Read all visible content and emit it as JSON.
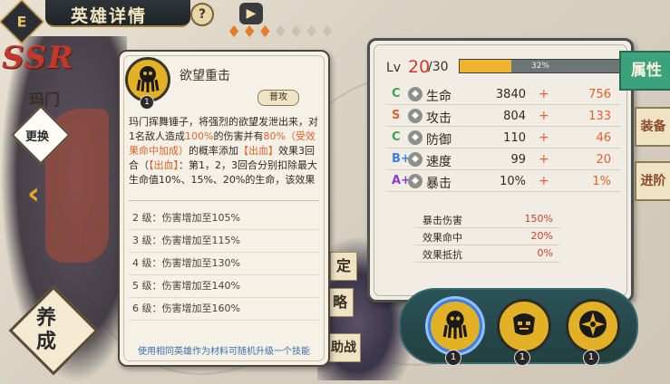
{
  "header": {
    "back_icon": "back-icon",
    "back_glyph": "E",
    "title": "英雄详情",
    "help_label": "?",
    "play_label": "▶",
    "stars_lit": 3,
    "stars_total": 7
  },
  "hero": {
    "rarity": "SSR",
    "name": "玛门",
    "change_label": "更换",
    "train_label": "养成"
  },
  "side_tabs": [
    "定",
    "略",
    "助战"
  ],
  "skill_card": {
    "icon": "octopus-skill-icon",
    "level": "1",
    "name": "欲望重击",
    "tag": "普攻",
    "desc_parts": [
      {
        "text": "玛门挥舞锤子，将强烈的欲望发泄出来，对1名敌人造成",
        "style": "plain"
      },
      {
        "text": "100%",
        "style": "orange"
      },
      {
        "text": "的伤害并有",
        "style": "plain"
      },
      {
        "text": "80%（受效果命中加成）",
        "style": "orange"
      },
      {
        "text": "的概率添加",
        "style": "plain"
      },
      {
        "text": "【出血】",
        "style": "orange"
      },
      {
        "text": "效果3回合（",
        "style": "plain"
      },
      {
        "text": "【出血】",
        "style": "orange"
      },
      {
        "text": "：第1，2，3回合分别扣除最大生命值10%、15%、20%的生命，该效果",
        "style": "plain"
      }
    ],
    "upgrades": [
      "2 级：伤害增加至105%",
      "3 级：伤害增加至115%",
      "4 级：伤害增加至130%",
      "5 级：伤害增加至140%",
      "6 级：伤害增加至160%"
    ],
    "footer": "使用相同英雄作为材料可随机升级一个技能"
  },
  "stats": {
    "lv_label": "Lv",
    "lv_current": "20",
    "lv_max": "/30",
    "xp_percent_text": "32%",
    "xp_fraction": 0.32,
    "rows": [
      {
        "grade": "C",
        "grade_color": "#3aa24a",
        "icon": "heart-icon",
        "name": "生命",
        "value": "3840",
        "plus": "+",
        "bonus": "756"
      },
      {
        "grade": "S",
        "grade_color": "#e0622a",
        "icon": "sword-icon",
        "name": "攻击",
        "value": "804",
        "plus": "+",
        "bonus": "133"
      },
      {
        "grade": "C",
        "grade_color": "#3aa24a",
        "icon": "shield-icon",
        "name": "防御",
        "value": "110",
        "plus": "+",
        "bonus": "46"
      },
      {
        "grade": "B+",
        "grade_color": "#3a7ee6",
        "icon": "speed-icon",
        "name": "速度",
        "value": "99",
        "plus": "+",
        "bonus": "20"
      },
      {
        "grade": "A+",
        "grade_color": "#8a3ad1",
        "icon": "crit-icon",
        "name": "暴击",
        "value": "10%",
        "plus": "+",
        "bonus": "1%"
      }
    ],
    "sub_rows": [
      {
        "name": "暴击伤害",
        "value": "150%"
      },
      {
        "name": "效果命中",
        "value": "20%"
      },
      {
        "name": "效果抵抗",
        "value": "0%"
      }
    ]
  },
  "right_tabs": [
    "属性",
    "装备",
    "进阶"
  ],
  "skill_strip": [
    {
      "icon": "octopus-skill-icon",
      "level": "1",
      "selected": true
    },
    {
      "icon": "mask-skill-icon",
      "level": "1",
      "selected": false
    },
    {
      "icon": "cross-skill-icon",
      "level": "1",
      "selected": false
    }
  ]
}
